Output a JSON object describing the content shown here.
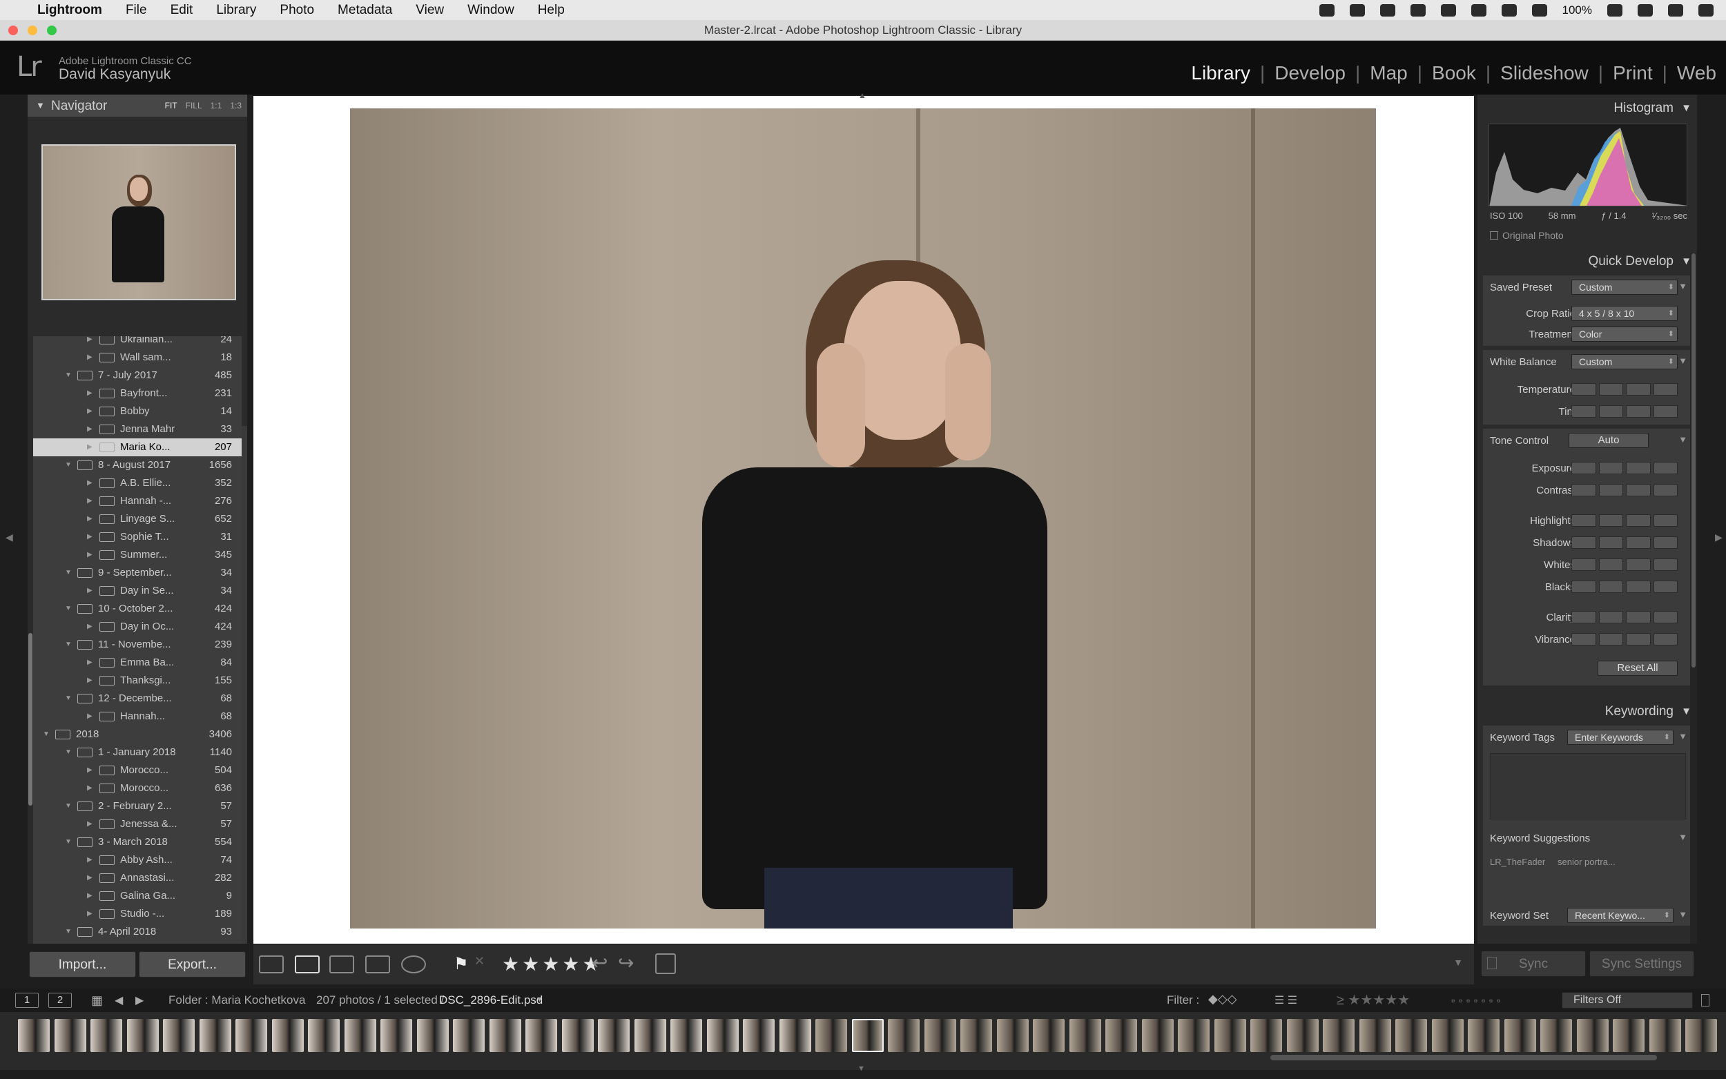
{
  "menubar": {
    "app_name": "Lightroom",
    "items": [
      "File",
      "Edit",
      "Library",
      "Photo",
      "Metadata",
      "View",
      "Window",
      "Help"
    ],
    "battery": "100%"
  },
  "window": {
    "title": "Master-2.lrcat - Adobe Photoshop Lightroom Classic - Library"
  },
  "identity": {
    "logo": "Lr",
    "product": "Adobe Lightroom Classic CC",
    "user": "David Kasyanyuk"
  },
  "modules": [
    "Library",
    "Develop",
    "Map",
    "Book",
    "Slideshow",
    "Print",
    "Web"
  ],
  "navigator": {
    "title": "Navigator",
    "zoom": [
      "FIT",
      "FILL",
      "1:1",
      "1:3"
    ]
  },
  "folders": [
    {
      "name": "Ukrainian...",
      "count": "24",
      "level": 2,
      "expanded": false
    },
    {
      "name": "Wall sam...",
      "count": "18",
      "level": 2,
      "expanded": false
    },
    {
      "name": "7 - July 2017",
      "count": "485",
      "level": 1,
      "expanded": true
    },
    {
      "name": "Bayfront...",
      "count": "231",
      "level": 2,
      "expanded": false
    },
    {
      "name": "Bobby",
      "count": "14",
      "level": 2,
      "expanded": false
    },
    {
      "name": "Jenna Mahr",
      "count": "33",
      "level": 2,
      "expanded": false
    },
    {
      "name": "Maria Ko...",
      "count": "207",
      "level": 2,
      "expanded": false,
      "selected": true
    },
    {
      "name": "8 - August 2017",
      "count": "1656",
      "level": 1,
      "expanded": true
    },
    {
      "name": "A.B. Ellie...",
      "count": "352",
      "level": 2,
      "expanded": false
    },
    {
      "name": "Hannah -...",
      "count": "276",
      "level": 2,
      "expanded": false
    },
    {
      "name": "Linyage S...",
      "count": "652",
      "level": 2,
      "expanded": false
    },
    {
      "name": "Sophie T...",
      "count": "31",
      "level": 2,
      "expanded": false
    },
    {
      "name": "Summer...",
      "count": "345",
      "level": 2,
      "expanded": false
    },
    {
      "name": "9 - September...",
      "count": "34",
      "level": 1,
      "expanded": true
    },
    {
      "name": "Day in Se...",
      "count": "34",
      "level": 2,
      "expanded": false
    },
    {
      "name": "10 - October 2...",
      "count": "424",
      "level": 1,
      "expanded": true
    },
    {
      "name": "Day in Oc...",
      "count": "424",
      "level": 2,
      "expanded": false
    },
    {
      "name": "11 - Novembe...",
      "count": "239",
      "level": 1,
      "expanded": true
    },
    {
      "name": "Emma Ba...",
      "count": "84",
      "level": 2,
      "expanded": false
    },
    {
      "name": "Thanksgi...",
      "count": "155",
      "level": 2,
      "expanded": false
    },
    {
      "name": "12 - Decembe...",
      "count": "68",
      "level": 1,
      "expanded": true
    },
    {
      "name": "Hannah...",
      "count": "68",
      "level": 2,
      "expanded": false
    },
    {
      "name": "2018",
      "count": "3406",
      "level": 0,
      "expanded": true
    },
    {
      "name": "1 - January 2018",
      "count": "1140",
      "level": 1,
      "expanded": true
    },
    {
      "name": "Morocco...",
      "count": "504",
      "level": 2,
      "expanded": false
    },
    {
      "name": "Morocco...",
      "count": "636",
      "level": 2,
      "expanded": false
    },
    {
      "name": "2 - February 2...",
      "count": "57",
      "level": 1,
      "expanded": true
    },
    {
      "name": "Jenessa &...",
      "count": "57",
      "level": 2,
      "expanded": false
    },
    {
      "name": "3 - March 2018",
      "count": "554",
      "level": 1,
      "expanded": true
    },
    {
      "name": "Abby Ash...",
      "count": "74",
      "level": 2,
      "expanded": false
    },
    {
      "name": "Annastasi...",
      "count": "282",
      "level": 2,
      "expanded": false
    },
    {
      "name": "Galina Ga...",
      "count": "9",
      "level": 2,
      "expanded": false
    },
    {
      "name": "Studio -...",
      "count": "189",
      "level": 2,
      "expanded": false
    },
    {
      "name": "4- April 2018",
      "count": "93",
      "level": 1,
      "expanded": true
    }
  ],
  "left_buttons": {
    "import": "Import...",
    "export": "Export..."
  },
  "toolbar": {
    "stars": "★★★★★"
  },
  "histogram": {
    "title": "Histogram",
    "iso": "ISO 100",
    "focal": "58 mm",
    "aperture": "ƒ / 1.4",
    "shutter": "¹⁄₃₂₀₀ sec",
    "original_photo": "Original Photo"
  },
  "quick_develop": {
    "title": "Quick Develop",
    "saved_preset_label": "Saved Preset",
    "saved_preset_value": "Custom",
    "crop_label": "Crop Ratio",
    "crop_value": "4 x 5  /  8 x 10",
    "treatment_label": "Treatment",
    "treatment_value": "Color",
    "wb_label": "White Balance",
    "wb_value": "Custom",
    "temperature": "Temperature",
    "tint": "Tint",
    "tone_label": "Tone Control",
    "auto": "Auto",
    "exposure": "Exposure",
    "contrast": "Contrast",
    "highlights": "Highlights",
    "shadows": "Shadows",
    "whites": "Whites",
    "blacks": "Blacks",
    "clarity": "Clarity",
    "vibrance": "Vibrance",
    "reset_all": "Reset All"
  },
  "keywording": {
    "title": "Keywording",
    "tags_label": "Keyword Tags",
    "tags_value": "Enter Keywords",
    "suggestions_label": "Keyword Suggestions",
    "suggestion_1": "LR_TheFader",
    "suggestion_2": "senior portra...",
    "set_label": "Keyword Set",
    "set_value": "Recent Keywo..."
  },
  "sync": {
    "sync": "Sync",
    "sync_settings": "Sync Settings"
  },
  "filmbar": {
    "screen1": "1",
    "screen2": "2",
    "folder": "Folder : Maria Kochetkova",
    "count": "207 photos / 1 selected /",
    "filename": "DSC_2896-Edit.psd",
    "filter_label": "Filter :",
    "filters_off": "Filters Off"
  }
}
